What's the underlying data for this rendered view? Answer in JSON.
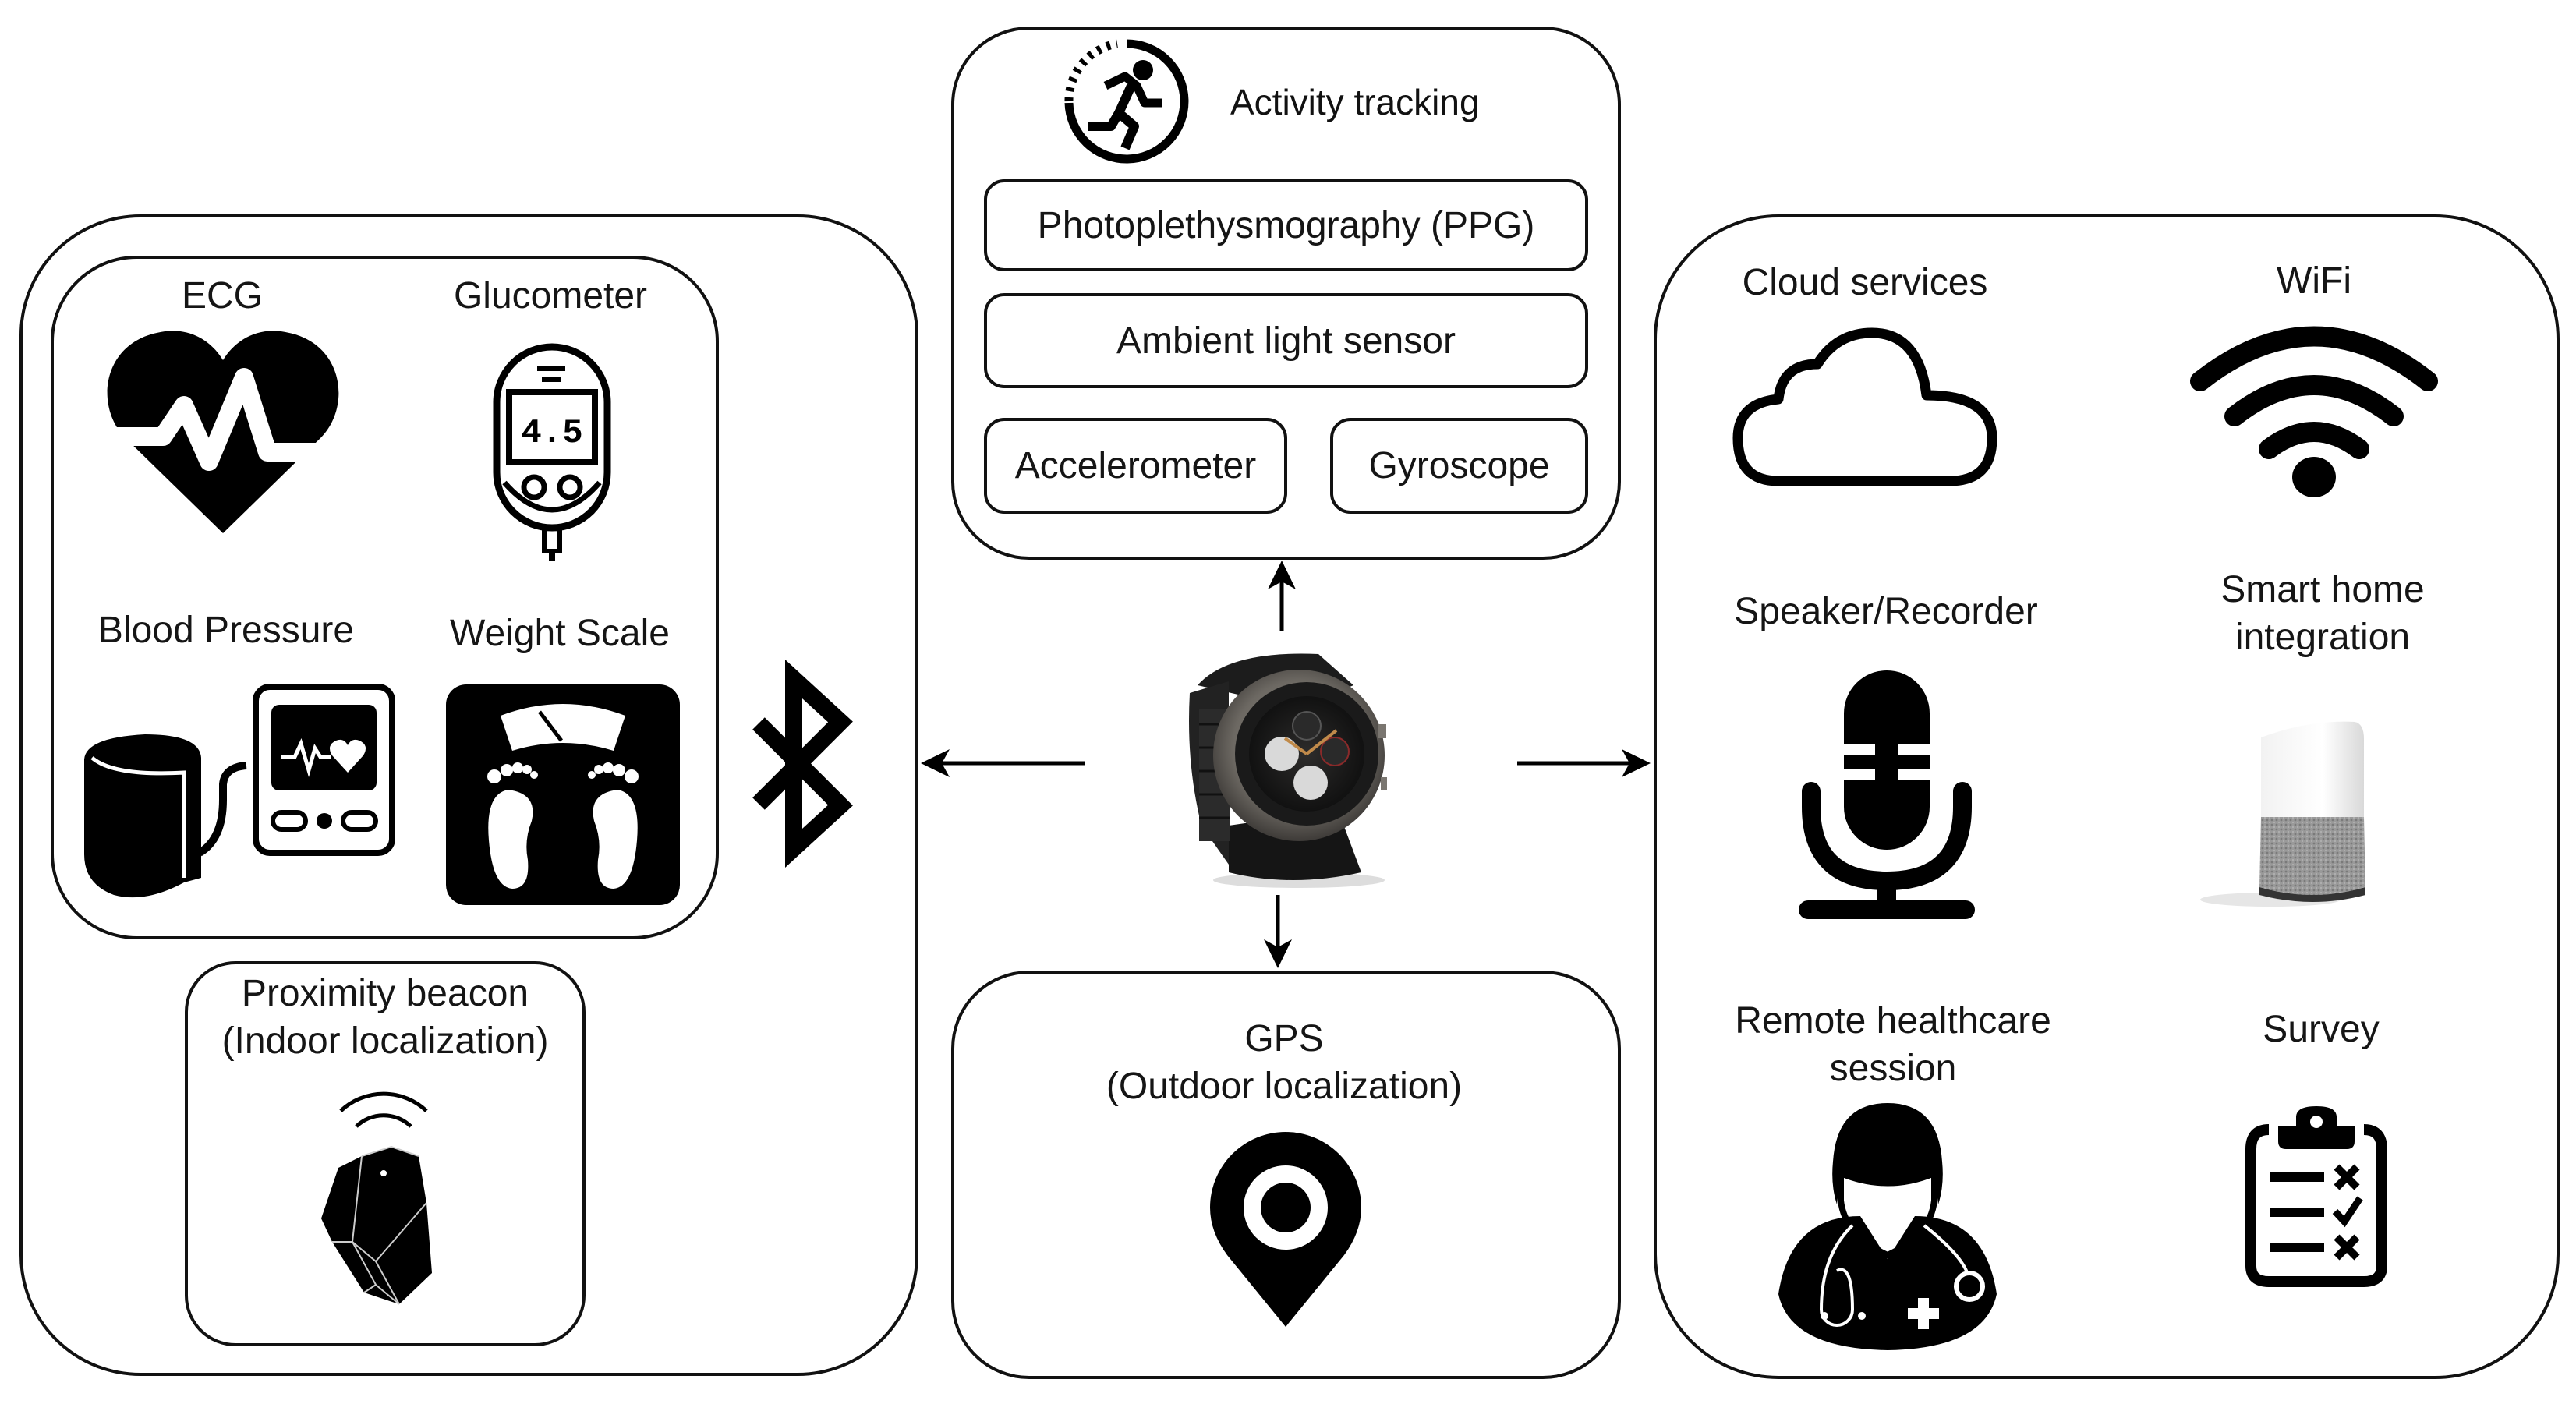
{
  "diagram": {
    "center_device": {
      "name": "Smartwatch",
      "icon": "smartwatch-image"
    },
    "left_panel": {
      "devices_group": [
        {
          "label": "ECG",
          "icon": "heart-pulse-icon"
        },
        {
          "label": "Glucometer",
          "icon": "glucometer-icon",
          "display_value": "4.5"
        },
        {
          "label": "Blood Pressure",
          "icon": "blood-pressure-monitor-icon"
        },
        {
          "label": "Weight Scale",
          "icon": "weight-scale-icon"
        }
      ],
      "beacon": {
        "line1": "Proximity beacon",
        "line2": "(Indoor localization)",
        "icon": "proximity-beacon-icon"
      },
      "connection_icon": "bluetooth-icon"
    },
    "top_panel": {
      "title": "Activity tracking",
      "icon": "running-activity-icon",
      "sensors": [
        "Photoplethysmography (PPG)",
        "Ambient light sensor",
        "Accelerometer",
        "Gyroscope"
      ]
    },
    "bottom_panel": {
      "line1": "GPS",
      "line2": "(Outdoor localization)",
      "icon": "location-pin-icon"
    },
    "right_panel": {
      "items": [
        {
          "label": "Cloud services",
          "icon": "cloud-icon"
        },
        {
          "label": "WiFi",
          "icon": "wifi-icon"
        },
        {
          "label": "Speaker/Recorder",
          "icon": "microphone-icon"
        },
        {
          "line1": "Smart home",
          "line2": "integration",
          "icon": "smart-speaker-icon"
        },
        {
          "line1": "Remote healthcare",
          "line2": "session",
          "icon": "doctor-icon"
        },
        {
          "label": "Survey",
          "icon": "clipboard-checklist-icon"
        }
      ]
    },
    "arrows": [
      {
        "from": "smartwatch",
        "to": "left_panel"
      },
      {
        "from": "smartwatch",
        "to": "top_panel"
      },
      {
        "from": "smartwatch",
        "to": "bottom_panel"
      },
      {
        "from": "smartwatch",
        "to": "right_panel"
      }
    ]
  }
}
